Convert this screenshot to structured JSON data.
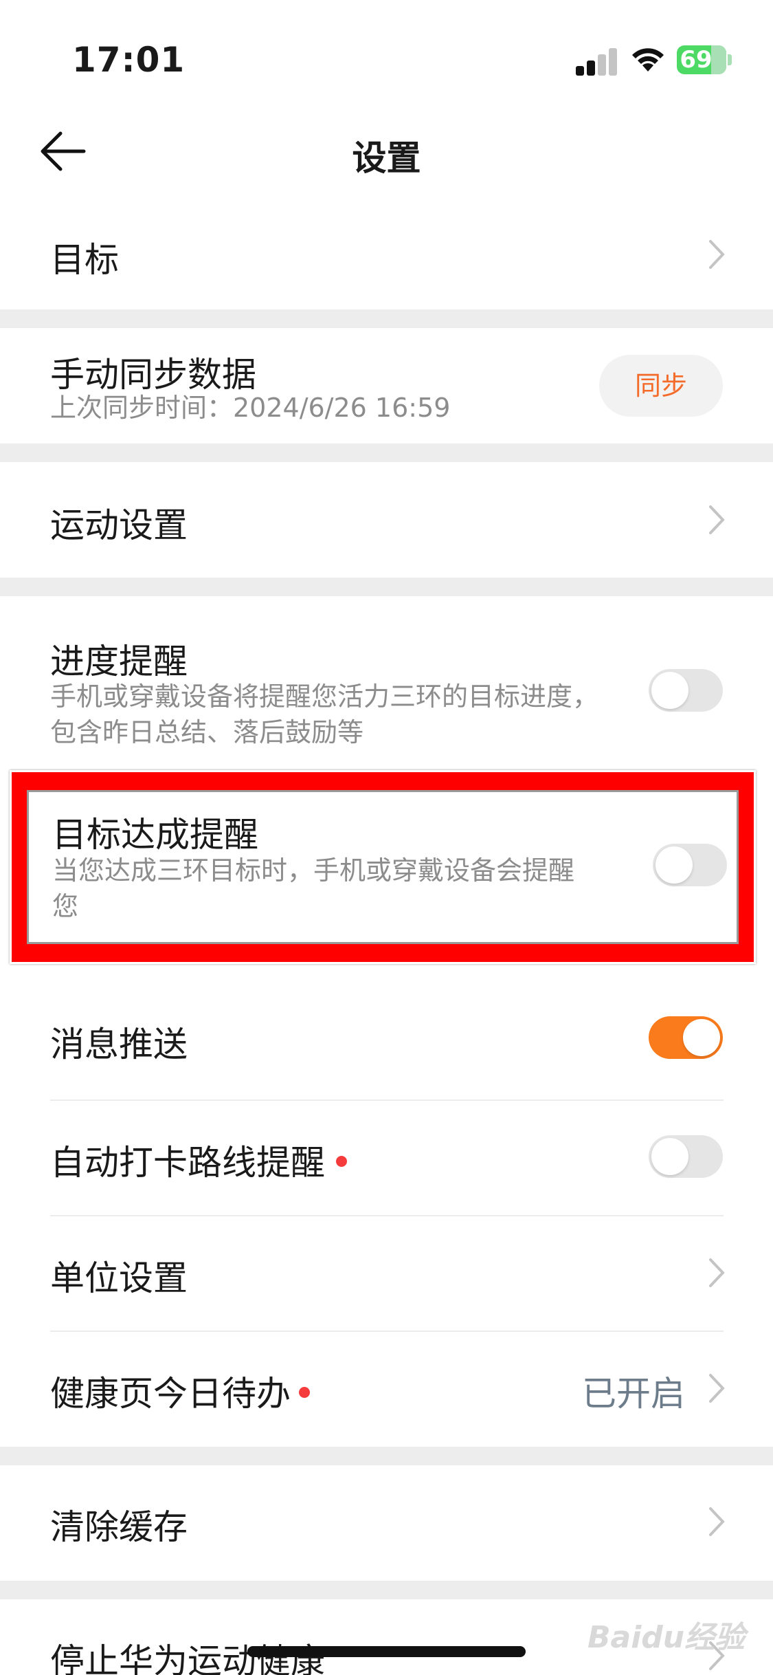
{
  "status_bar": {
    "time": "17:01",
    "battery": "69"
  },
  "header": {
    "title": "设置"
  },
  "rows": {
    "goal": {
      "title": "目标"
    },
    "manual_sync": {
      "title": "手动同步数据",
      "subtitle": "上次同步时间：2024/6/26 16:59",
      "button": "同步"
    },
    "exercise_settings": {
      "title": "运动设置"
    },
    "progress_reminder": {
      "title": "进度提醒",
      "subtitle": "手机或穿戴设备将提醒您活力三环的目标进度，包含昨日总结、落后鼓励等",
      "on": false
    },
    "goal_achieved_reminder": {
      "title": "目标达成提醒",
      "subtitle": "当您达成三环目标时，手机或穿戴设备会提醒您",
      "on": false
    },
    "message_push": {
      "title": "消息推送",
      "on": true
    },
    "auto_checkin_route": {
      "title": "自动打卡路线提醒",
      "on": false
    },
    "unit_settings": {
      "title": "单位设置"
    },
    "health_todo": {
      "title": "健康页今日待办",
      "value": "已开启"
    },
    "clear_cache": {
      "title": "清除缓存"
    },
    "stop_service": {
      "title": "停止华为运动健康"
    }
  },
  "watermark": "Baidu经验",
  "colors": {
    "accent": "#fa7b1c",
    "sync_text": "#f46b2a",
    "highlight": "#ff0000",
    "dot": "#f53b3b"
  }
}
